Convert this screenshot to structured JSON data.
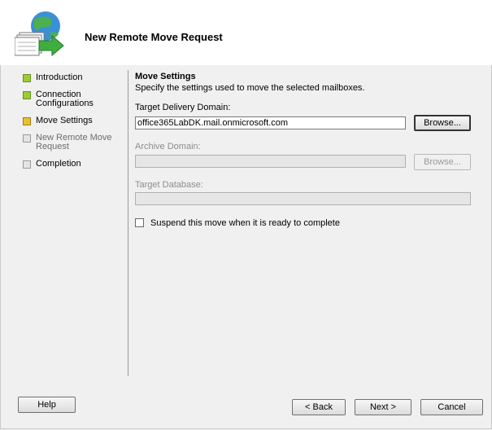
{
  "header": {
    "title": "New Remote Move Request"
  },
  "nav": {
    "items": [
      {
        "label": "Introduction",
        "status": "done"
      },
      {
        "label": "Connection\nConfigurations",
        "status": "done"
      },
      {
        "label": "Move Settings",
        "status": "current"
      },
      {
        "label": "New Remote Move\nRequest",
        "status": "pending"
      },
      {
        "label": "Completion",
        "status": "pending"
      }
    ]
  },
  "settings": {
    "section_title": "Move Settings",
    "description": "Specify the settings used to move the selected mailboxes.",
    "target_domain_label": "Target Delivery Domain:",
    "target_domain_value": "office365LabDK.mail.onmicrosoft.com",
    "browse_label": "Browse...",
    "archive_domain_label": "Archive Domain:",
    "archive_domain_value": "",
    "archive_browse_label": "Browse...",
    "target_database_label": "Target Database:",
    "target_database_value": "",
    "suspend_label": "Suspend this move when it is ready to complete",
    "suspend_checked": false
  },
  "footer": {
    "help_label": "Help",
    "back_label": "< Back",
    "next_label": "Next >",
    "cancel_label": "Cancel"
  },
  "colors": {
    "done": "#9acd32",
    "current": "#e8c030",
    "pending": "#e4e4e4"
  }
}
